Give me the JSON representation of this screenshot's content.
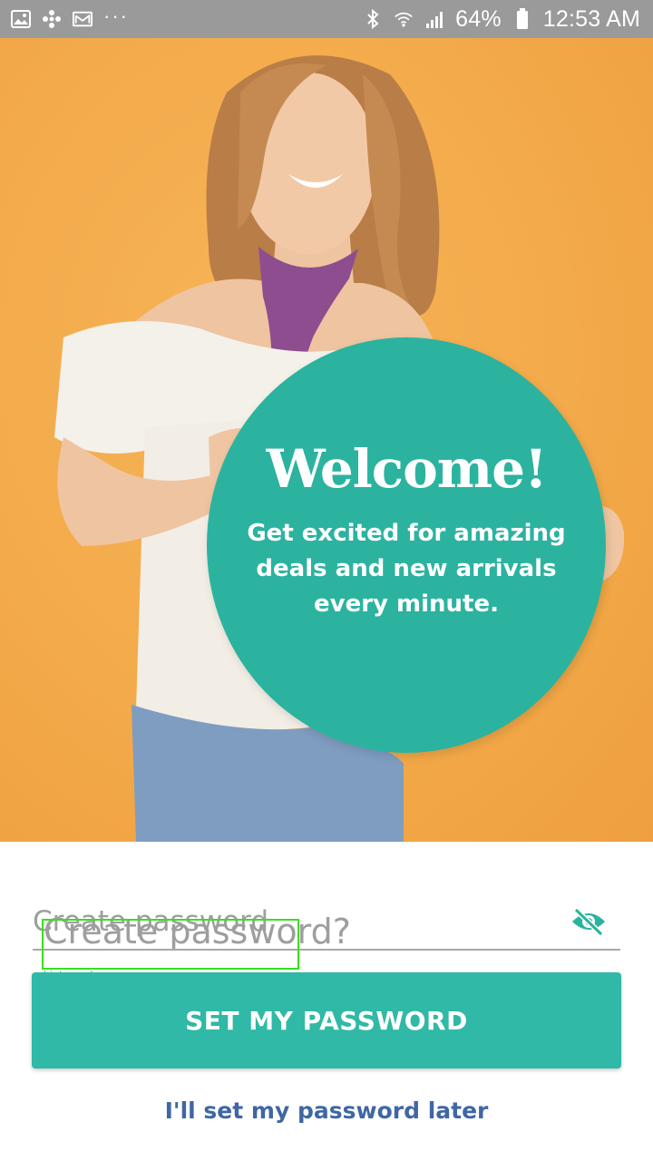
{
  "status_bar": {
    "left_icons": [
      "image-icon",
      "fan-icon",
      "mail-icon",
      "more-dots-icon"
    ],
    "right_icons": [
      "bluetooth-icon",
      "wifi-icon",
      "signal-icon",
      "battery-icon"
    ],
    "battery_percent": "64%",
    "time": "12:53 AM"
  },
  "hero": {
    "welcome_title": "Welcome!",
    "welcome_message": "Get excited for amazing deals and new arrivals every minute.",
    "colors": {
      "background": "#f3aa4a",
      "circle": "#2bb3a0"
    }
  },
  "password_form": {
    "label": "Create password",
    "placeholder": "Create password?",
    "value": "",
    "visibility_icon": "eye-off-icon",
    "debug_label": "hint_overlap"
  },
  "actions": {
    "primary_button_label": "SET MY PASSWORD",
    "secondary_link_label": "I'll set my password later",
    "colors": {
      "primary": "#2fb9a6",
      "link": "#3f67a3"
    }
  }
}
